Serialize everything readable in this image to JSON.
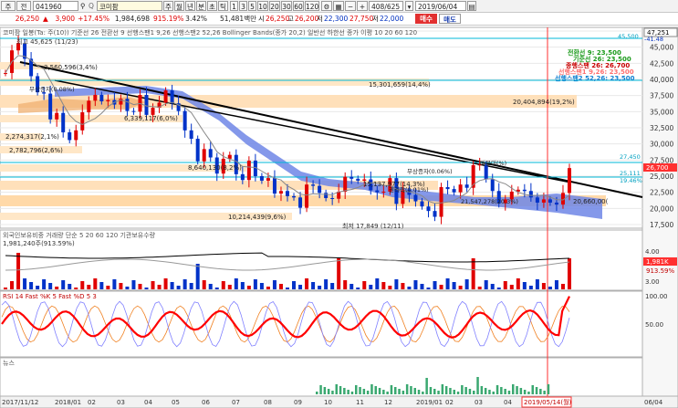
{
  "toolbar1": {
    "menu1": "주",
    "menu2": "전",
    "code": "041960",
    "code_mark": "Q",
    "name": "코미팜",
    "periods": [
      "주",
      "월",
      "년",
      "분",
      "초",
      "틱"
    ],
    "nums": [
      "1",
      "3",
      "5",
      "10",
      "20",
      "30",
      "60",
      "120"
    ],
    "counter": "408/625",
    "date": "2019/06/04"
  },
  "toolbar2": {
    "price": "26,250",
    "change": "3,900",
    "change_pct": "+17.45%",
    "volume": "1,984,698",
    "vol_ratio": "915.19%",
    "turnover": "3.42%",
    "amount": "51,481백만",
    "open_label": "시",
    "high_label": "고",
    "open": "26,250",
    "high": "26,200",
    "low_label": "저",
    "low_box": "22,300",
    "v1": "27,750",
    "v2_label": "저",
    "v2": "22,000",
    "buy": "매수",
    "sell": "매도"
  },
  "price_panel": {
    "legend": "코미팜 일봉(Ta: 주(10))  기준선 26  전환선 9  선행스팬1 9,26  선행스팬2 52,26  Bollinger Bands(종가 20,2) 일반선 하한선  종가 이평 10 20 60 120",
    "scale_ticks": [
      "47,500",
      "45,000",
      "42,500",
      "40,000",
      "37,500",
      "35,000",
      "32,500",
      "30,000",
      "27,500",
      "25,000",
      "22,500",
      "20,000",
      "17,500"
    ],
    "current_price_tag": "26,700",
    "top_tag": "47,251",
    "top_tag2": "-41.48",
    "level_45": "45,500",
    "level_27": "27,450",
    "level_25": "25,111",
    "level_hl": "19.46%",
    "max_label": "최고 45,625 (11/23)",
    "min_label": "최저 17,849 (12/11)",
    "ichimoku": {
      "l1": "전환선  9: 23,500",
      "l2": "기준선 26: 23,500",
      "l3": "종행스팬 26: 26,700",
      "l4": "선행스팬1 9,26: 23,500",
      "l5": "선행스팬2 52,26: 23,500"
    },
    "vp": [
      "3,560,596(3,4%)",
      "2,274,317(2,1%)",
      "2,782,796(2,6%)",
      "6,339,117(6,0%)",
      "8,640,130(8,2%)",
      "15,301,659(14,4%)",
      "20,404,894(19,2%)",
      "10,214,439(9,6%)",
      "15,137,977(14,3%)",
      "21,547,278(20,3%)",
      "20,660,00(",
      "무상증자(0.06%)",
      "무상증자(0.08%)",
      "권리락(0.01%)",
      "매물대(%)"
    ]
  },
  "volume_panel": {
    "legend": "외국인보유비중  거래량  단순 5  20  60  120  기관보유수량",
    "value": "1,981,240주(913.59%)",
    "ticks": [
      "4.00",
      "3.00"
    ],
    "tag1": "1,981K",
    "tag2": "913.59%"
  },
  "rsi_panel": {
    "legend": "RSI 14  Fast %K 5  Fast %D 5 3",
    "ticks": [
      "100.00",
      "50.00"
    ]
  },
  "news_panel": {
    "legend": "뉴스"
  },
  "x_axis": {
    "labels": [
      "2017/11/12",
      "2018/01",
      "02",
      "03",
      "04",
      "05",
      "06",
      "07",
      "08",
      "09",
      "10",
      "11",
      "12",
      "2019/01",
      "02",
      "03",
      "04",
      "05",
      "06/04"
    ],
    "cursor": "2019/05/14(월)"
  },
  "colors": {
    "candle_up": "#e00000",
    "candle_down": "#0032c8",
    "cloud": "#6f86e6",
    "cloud2": "#f0b070",
    "band": "#ffe9cf",
    "trend": "#000000",
    "rsi": "#ff0000",
    "cyan": "#00b8d8"
  },
  "price_series": [
    41000,
    44500,
    45600,
    43200,
    40500,
    38000,
    37800,
    33800,
    34800,
    31800,
    30600,
    32100,
    34900,
    36700,
    37600,
    36600,
    36800,
    36100,
    37000,
    35100,
    35000,
    37600,
    34500,
    35600,
    36400,
    38300,
    36300,
    35100,
    32100,
    30800,
    27300,
    29200,
    27900,
    25400,
    27700,
    28300,
    25300,
    24400,
    27400,
    25000,
    24300,
    24700,
    22300,
    22700,
    21900,
    21700,
    20100,
    23700,
    23500,
    22400,
    21600,
    21500,
    22600,
    24900,
    24600,
    24300,
    24500,
    22800,
    22500,
    22600,
    24700,
    20700,
    22900,
    22100,
    21100,
    20300,
    19600,
    18700,
    23300,
    23000,
    22500,
    23700,
    23200,
    26700,
    26800,
    24500,
    22700,
    20800,
    21400,
    22600,
    22900,
    22700,
    21700,
    20900,
    21400,
    20900,
    20600,
    22400,
    26250
  ]
}
